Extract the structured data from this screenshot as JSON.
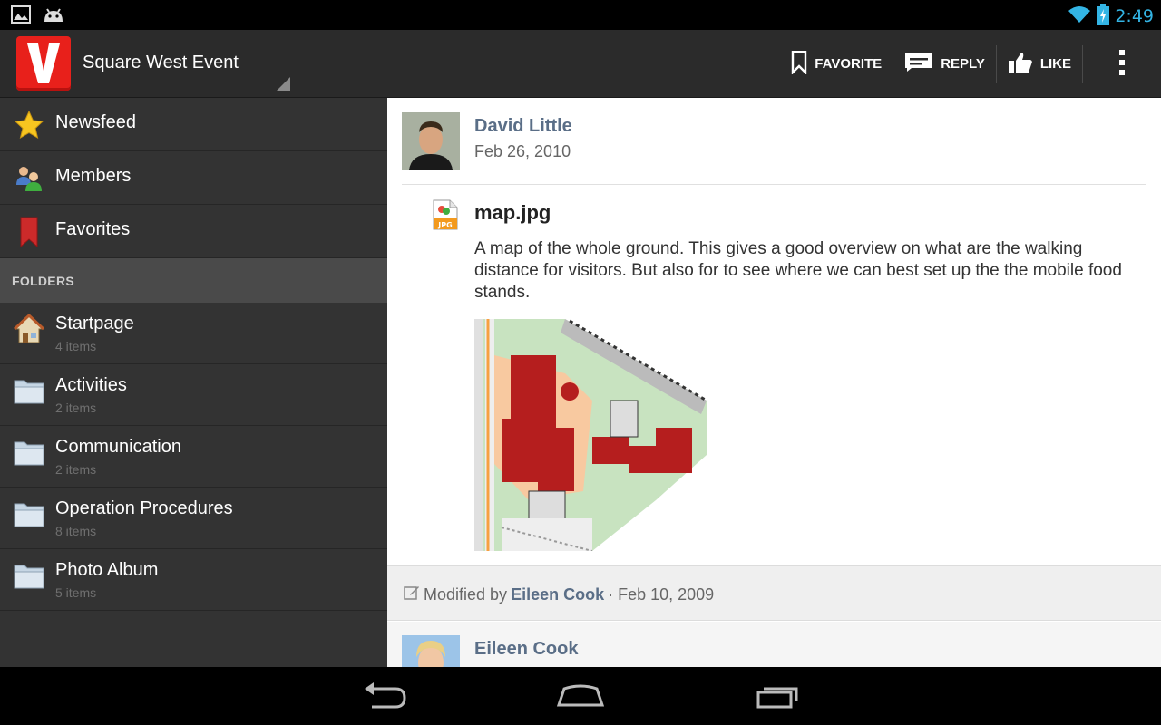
{
  "status": {
    "time": "2:49"
  },
  "app": {
    "title": "Square West Event",
    "actions": [
      {
        "id": "favorite",
        "label": "FAVORITE"
      },
      {
        "id": "reply",
        "label": "REPLY"
      },
      {
        "id": "like",
        "label": "LIKE"
      }
    ]
  },
  "sidebar": {
    "nav": [
      {
        "label": "Newsfeed",
        "icon": "star-icon"
      },
      {
        "label": "Members",
        "icon": "members-icon"
      },
      {
        "label": "Favorites",
        "icon": "bookmark-icon"
      }
    ],
    "folders_header": "FOLDERS",
    "folders": [
      {
        "label": "Startpage",
        "count": "4 items",
        "icon": "home-icon"
      },
      {
        "label": "Activities",
        "count": "2 items",
        "icon": "folder-icon"
      },
      {
        "label": "Communication",
        "count": "2 items",
        "icon": "folder-icon"
      },
      {
        "label": "Operation Procedures",
        "count": "8 items",
        "icon": "folder-icon"
      },
      {
        "label": "Photo Album",
        "count": "5 items",
        "icon": "folder-icon"
      }
    ]
  },
  "post": {
    "author": "David Little",
    "date": "Feb 26, 2010",
    "file_name": "map.jpg",
    "file_type_badge": "JPG",
    "description": "A map of the whole ground. This gives a good overview on what are the walking distance for visitors. But also for to see where we can best set up the the mobile food stands.",
    "modified_prefix": "Modified by",
    "modified_by": "Eileen Cook",
    "modified_date": "· Feb 10, 2009"
  },
  "next_post": {
    "author": "Eileen Cook"
  },
  "colors": {
    "accent": "#33b5e5",
    "brand": "#e8201b",
    "link": "#5a6e87"
  }
}
